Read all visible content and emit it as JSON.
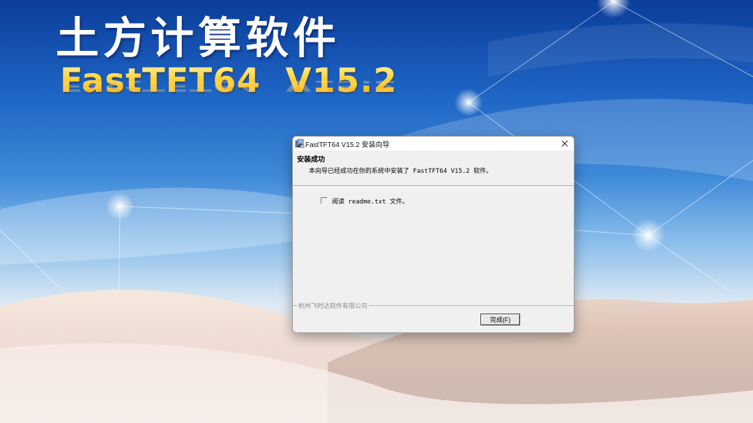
{
  "background": {
    "hero_title": "土方计算软件",
    "hero_version": "FastTFT64  V15.2"
  },
  "dialog": {
    "window_title": "FastTFT64 V15.2 安装向导",
    "app_icon": "installer-app-icon",
    "close_icon": "close-icon",
    "header_title": "安装成功",
    "header_message": "本向导已经成功在你的系统中安装了 FastTFT64 V15.2 软件。",
    "checkbox": {
      "label": "阅读 readme.txt 文件。",
      "checked": false
    },
    "company": "杭州飞时达软件有限公司",
    "finish_button": "完成(F)"
  },
  "colors": {
    "dialog_bg": "#f0f0f0",
    "title_gold": "#ffd23a",
    "sky_blue": "#1d64c4"
  }
}
